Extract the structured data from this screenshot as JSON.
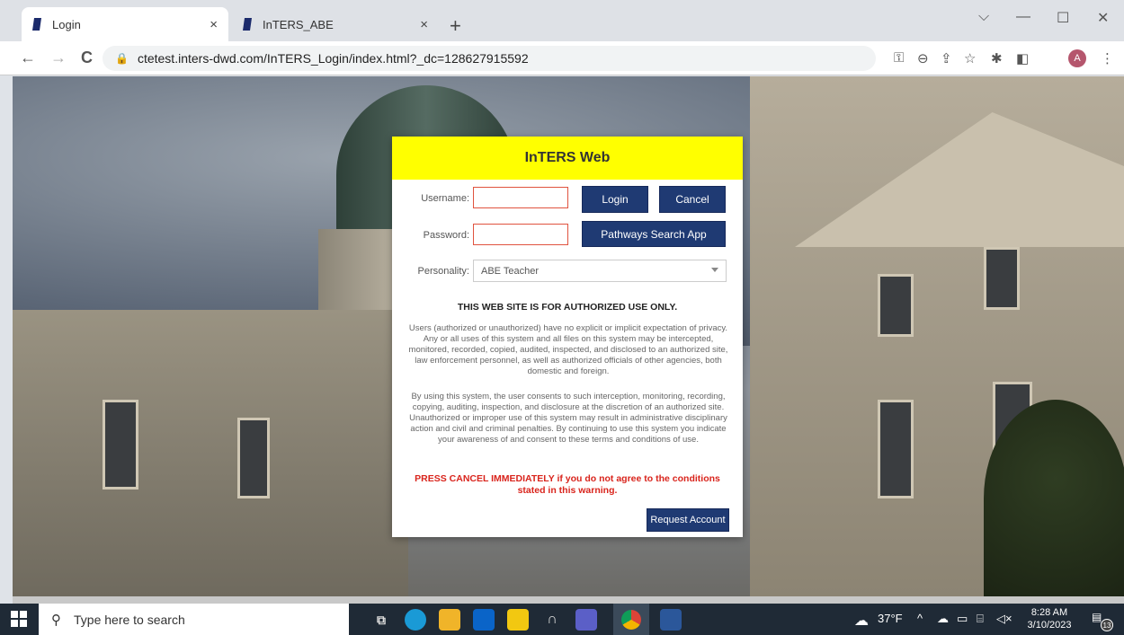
{
  "browser": {
    "tabs": [
      {
        "label": "Login"
      },
      {
        "label": "InTERS_ABE"
      }
    ],
    "tab_close": "×",
    "new_tab": "+",
    "window_controls": {
      "chevron": "⌵",
      "minimize": "—",
      "maximize": "☐",
      "close": "✕"
    },
    "nav": {
      "back": "←",
      "forward": "→",
      "reload": "C"
    },
    "url": "ctetest.inters-dwd.com/InTERS_Login/index.html?_dc=128627915592",
    "profile_initial": "A"
  },
  "dialog": {
    "title": "InTERS Web",
    "username_label": "Username:",
    "password_label": "Password:",
    "username_value": "",
    "password_value": "",
    "login_label": "Login",
    "cancel_label": "Cancel",
    "pathways_label": "Pathways Search App",
    "personality_label": "Personality:",
    "personality_value": "ABE Teacher",
    "notice_title": "THIS WEB SITE IS FOR AUTHORIZED USE ONLY.",
    "notice_p1": "Users (authorized or unauthorized) have no explicit or implicit expectation of privacy. Any or all uses of this system and all files on this system may be intercepted, monitored, recorded, copied, audited, inspected, and disclosed to an authorized site, law enforcement personnel, as well as authorized officials of other agencies, both domestic and foreign.",
    "notice_p2": "By using this system, the user consents to such interception, monitoring, recording, copying, auditing, inspection, and disclosure at the discretion of an authorized site. Unauthorized or improper use of this system may result in administrative disciplinary action and civil and criminal penalties. By continuing to use this system you indicate your awareness of and consent to these terms and conditions of use.",
    "warning": "PRESS CANCEL IMMEDIATELY if you do not agree to the conditions stated in this warning.",
    "request_label": "Request Account"
  },
  "taskbar": {
    "search_placeholder": "Type here to search",
    "weather": "37°F",
    "time": "8:28 AM",
    "date": "3/10/2023",
    "notification_count": "13"
  },
  "colors": {
    "header_yellow": "#ffff00",
    "button_navy": "#1f3a73",
    "warning_red": "#d9241c"
  }
}
